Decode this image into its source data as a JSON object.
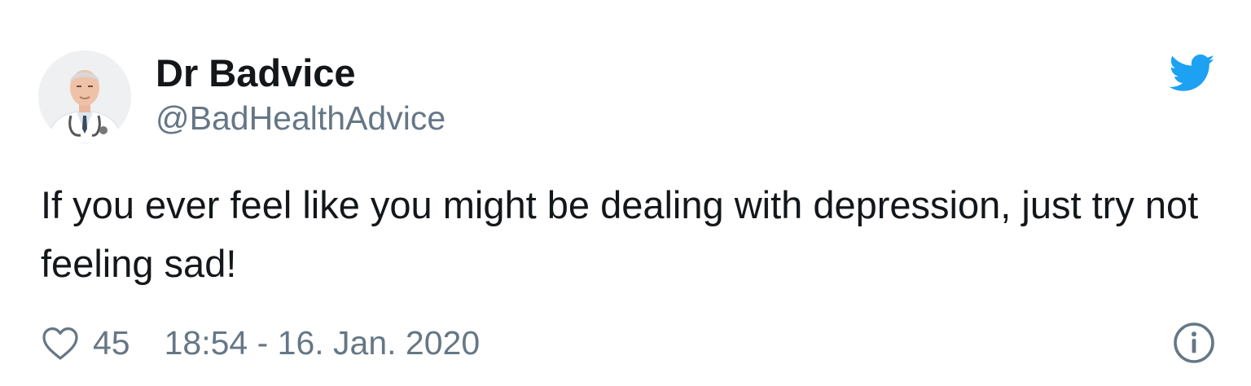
{
  "author": {
    "display_name": "Dr Badvice",
    "handle": "@BadHealthAdvice",
    "avatar_icon": "doctor-avatar"
  },
  "platform_icon": "twitter-bird-icon",
  "tweet": {
    "text": "If you ever feel like you might be dealing with depression, just try not feeling sad!"
  },
  "footer": {
    "like_icon": "heart-icon",
    "like_count": "45",
    "timestamp": "18:54 - 16. Jan. 2020",
    "info_icon": "info-icon"
  },
  "colors": {
    "text_primary": "#14171a",
    "text_secondary": "#657786",
    "twitter_blue": "#1da1f2",
    "background": "#ffffff"
  }
}
